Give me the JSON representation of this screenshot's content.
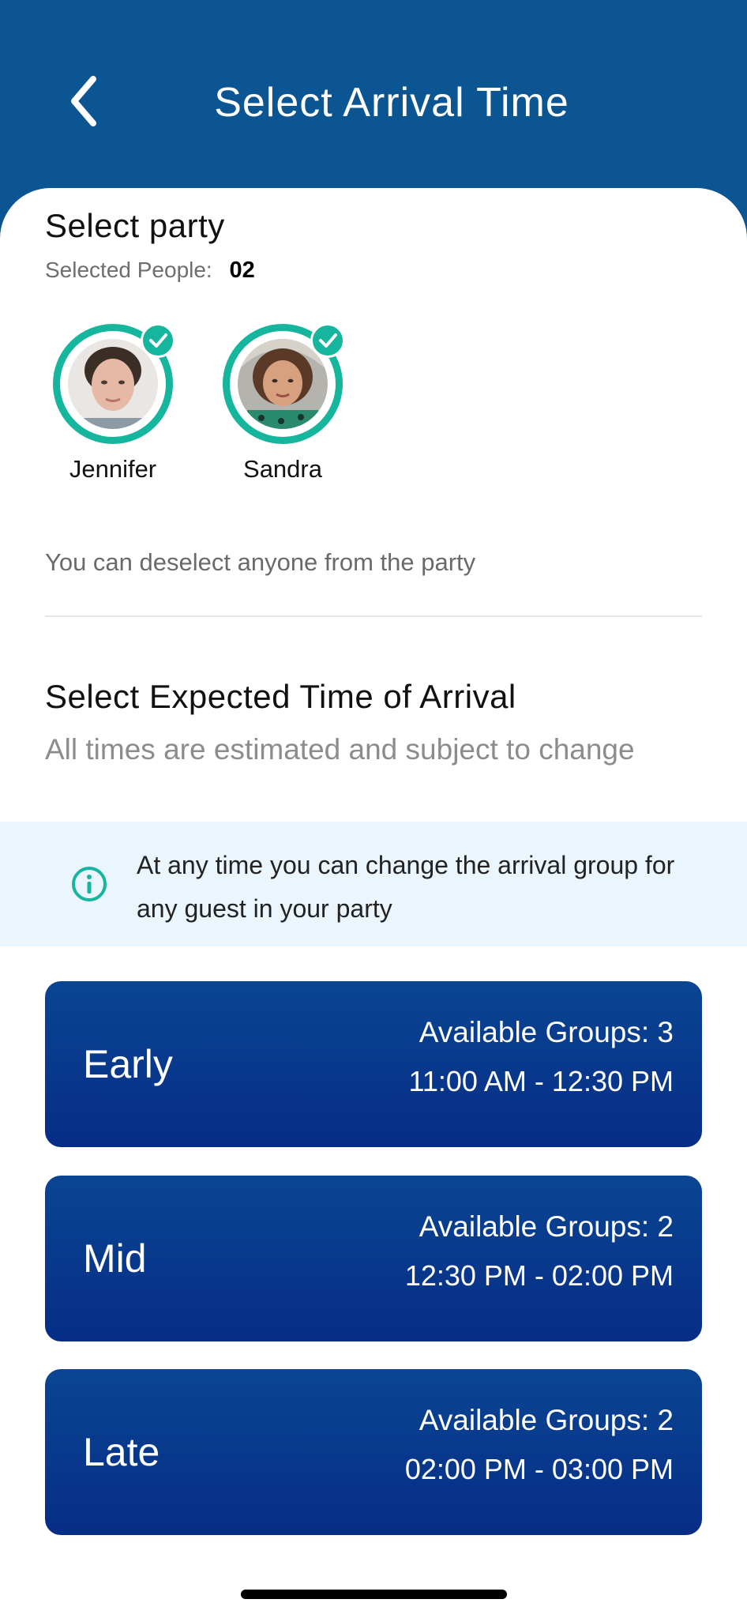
{
  "header": {
    "title": "Select Arrival Time",
    "back_icon": "chevron-left-icon"
  },
  "party": {
    "title": "Select party",
    "selected_label": "Selected People:",
    "selected_count": "02",
    "people": [
      {
        "name": "Jennifer",
        "selected": true
      },
      {
        "name": "Sandra",
        "selected": true
      }
    ],
    "hint": "You can deselect anyone from the party"
  },
  "arrival": {
    "title": "Select Expected Time of Arrival",
    "subtitle": "All times are estimated and subject to change",
    "info_icon": "info-circle-icon",
    "info_text": "At any time you can change the arrival group for any guest in your party",
    "slots": [
      {
        "name": "Early",
        "groups": "Available Groups: 3",
        "time": "11:00 AM - 12:30 PM"
      },
      {
        "name": "Mid",
        "groups": "Available Groups: 2",
        "time": "12:30 PM - 02:00 PM"
      },
      {
        "name": "Late",
        "groups": "Available Groups: 2",
        "time": "02:00 PM - 03:00 PM"
      }
    ]
  },
  "colors": {
    "header_bg": "#0a5592",
    "accent_teal": "#16b59d",
    "slot_bg": "#0a4592",
    "info_bg": "#ebf5fd"
  }
}
